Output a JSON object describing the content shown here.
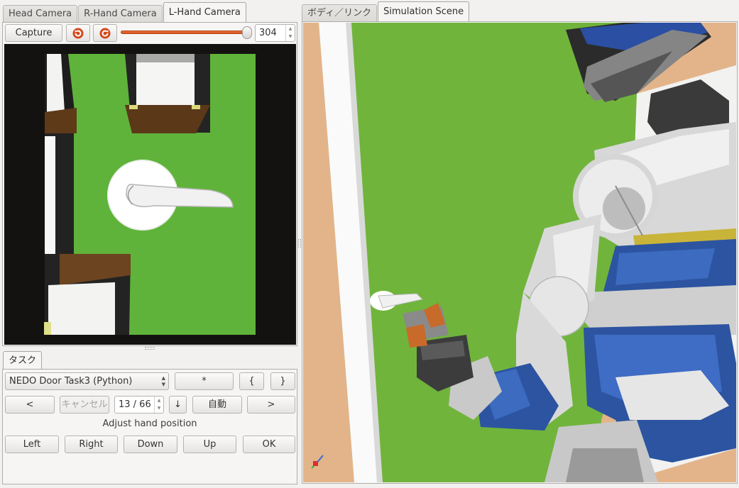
{
  "left_tabs": [
    "Head Camera",
    "R-Hand Camera",
    "L-Hand Camera"
  ],
  "right_tabs": [
    "ボディ／リンク",
    "Simulation Scene"
  ],
  "camera_toolbar": {
    "capture_label": "Capture",
    "slider_value": "304"
  },
  "task_panel": {
    "tab_label": "タスク",
    "task_select": "NEDO Door Task3 (Python)",
    "star_label": "*",
    "brace_open": "{",
    "brace_close": "}",
    "prev_label": "<",
    "cancel_label": "キャンセル",
    "step_counter": "13 / 66",
    "down_label": "↓",
    "auto_label": "自動",
    "next_label": ">",
    "instruction": "Adjust hand position",
    "direction_buttons": [
      "Left",
      "Right",
      "Down",
      "Up",
      "OK"
    ]
  },
  "colors": {
    "floor_green": "#70b43c",
    "door_brown": "#7a4a22",
    "robot_blue": "#2c54a0",
    "wall_tan": "#e3b48a"
  }
}
